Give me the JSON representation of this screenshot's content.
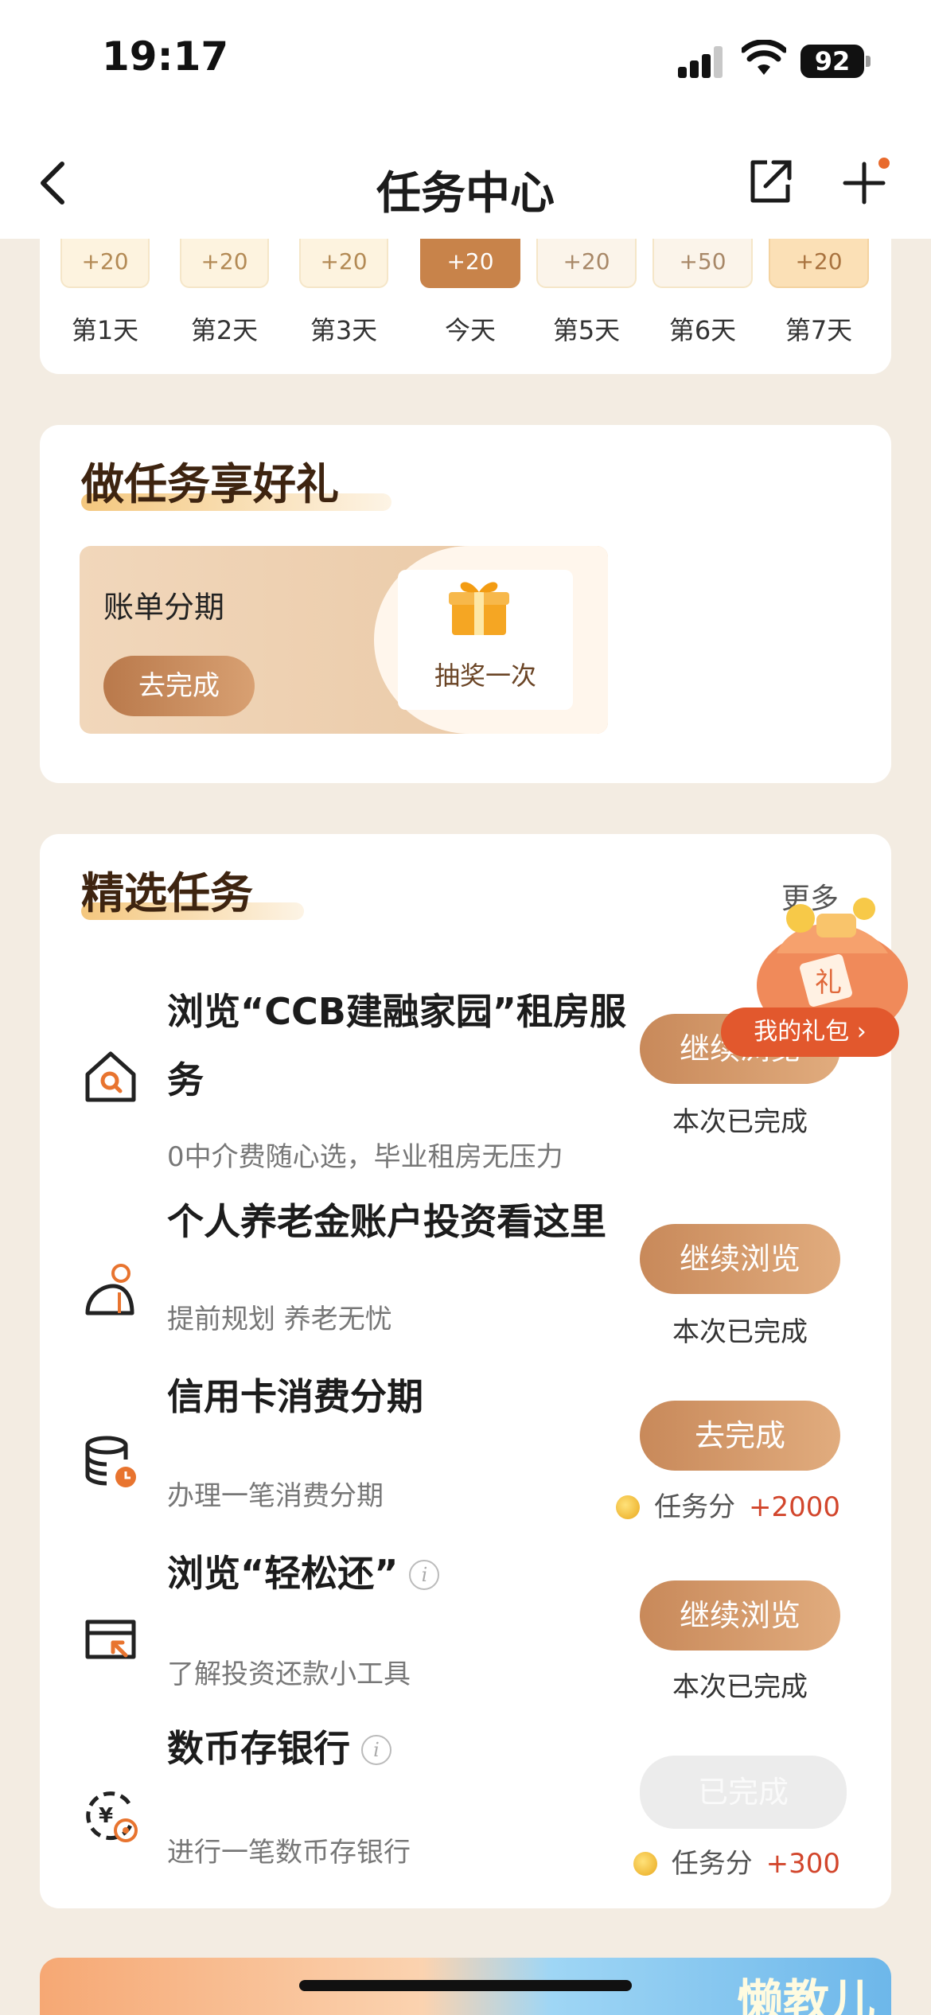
{
  "status_bar": {
    "time": "19:17",
    "battery": "92"
  },
  "nav": {
    "title": "任务中心",
    "back_icon": "chevron-left-icon",
    "share_icon": "share-icon",
    "plus_icon": "plus-icon"
  },
  "checkin": {
    "days": [
      {
        "points": "+20",
        "label": "第1天"
      },
      {
        "points": "+20",
        "label": "第2天"
      },
      {
        "points": "+20",
        "label": "第3天"
      },
      {
        "points": "+20",
        "label": "今天"
      },
      {
        "points": "+20",
        "label": "第5天"
      },
      {
        "points": "+50",
        "label": "第6天"
      },
      {
        "points": "+20",
        "label": "第7天"
      }
    ]
  },
  "gift_section": {
    "title": "做任务享好礼",
    "bill_title": "账单分期",
    "bill_button": "去完成",
    "prize_label": "抽奖一次"
  },
  "task_section": {
    "title": "精选任务",
    "more": "更多",
    "my_gift_bag": "我的礼包 ›",
    "bag_label": "礼",
    "tasks": [
      {
        "title_line1": "浏览“CCB建融家园”租房服",
        "title_line2": "务",
        "desc": "0中介费随心选，毕业租房无压力",
        "button": "继续浏览",
        "status": "本次已完成",
        "icon": "house-search-icon"
      },
      {
        "title": "个人养老金账户投资看这里",
        "desc": "提前规划 养老无忧",
        "button": "继续浏览",
        "status": "本次已完成",
        "icon": "elder-person-icon"
      },
      {
        "title": "信用卡消费分期",
        "desc": "办理一笔消费分期",
        "button": "去完成",
        "points_label": "任务分",
        "points_value": "+2000",
        "icon": "coin-stack-clock-icon"
      },
      {
        "title": "浏览“轻松还”",
        "desc": "了解投资还款小工具",
        "button": "继续浏览",
        "status": "本次已完成",
        "icon": "card-arrow-icon"
      },
      {
        "title": "数币存银行",
        "desc": "进行一笔数币存银行",
        "button": "已完成",
        "points_label": "任务分",
        "points_value": "+300",
        "icon": "digital-yuan-icon"
      }
    ]
  },
  "banner": {
    "text": "懒教儿"
  },
  "colors": {
    "accent": "#c8834a",
    "points_red": "#d2462c",
    "background": "#f3ece2"
  }
}
